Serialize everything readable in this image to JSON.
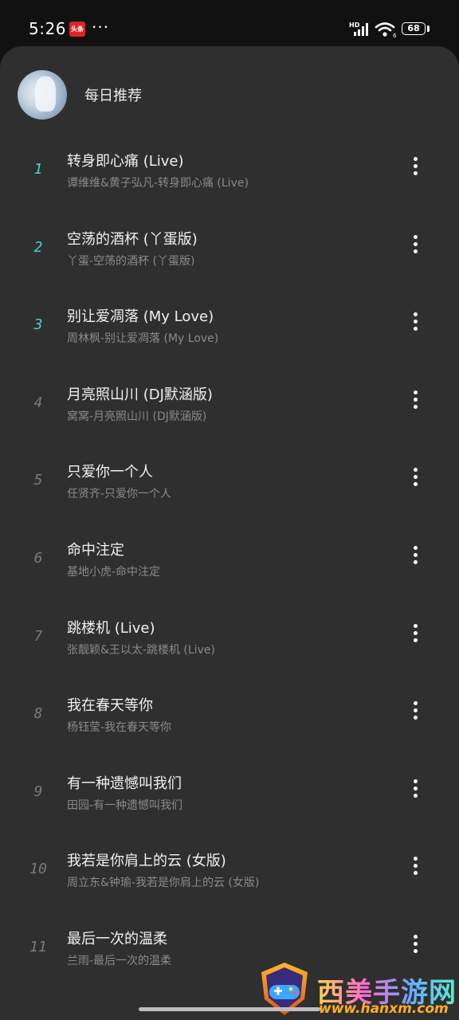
{
  "status_bar": {
    "time": "5:26",
    "news_icon_text": "头条",
    "more": "···",
    "hd_label": "HD",
    "wifi_sub": "6",
    "battery": "68"
  },
  "header": {
    "title": "每日推荐",
    "avatar": "avatar-image"
  },
  "songs": [
    {
      "num": "1",
      "title": "转身即心痛 (Live)",
      "subtitle": "谭维维&黄子弘凡-转身即心痛 (Live)",
      "highlight": true
    },
    {
      "num": "2",
      "title": "空荡的酒杯 (丫蛋版)",
      "subtitle": "丫蛋-空荡的酒杯 (丫蛋版)",
      "highlight": true
    },
    {
      "num": "3",
      "title": "别让爱凋落 (My Love)",
      "subtitle": "周林枫-别让爱凋落 (My Love)",
      "highlight": true
    },
    {
      "num": "4",
      "title": "月亮照山川 (DJ默涵版)",
      "subtitle": "窝窝-月亮照山川 (DJ默涵版)",
      "highlight": false
    },
    {
      "num": "5",
      "title": "只爱你一个人",
      "subtitle": "任贤齐-只爱你一个人",
      "highlight": false
    },
    {
      "num": "6",
      "title": "命中注定",
      "subtitle": "基地小虎-命中注定",
      "highlight": false
    },
    {
      "num": "7",
      "title": "跳楼机 (Live)",
      "subtitle": "张靓颖&王以太-跳楼机 (Live)",
      "highlight": false
    },
    {
      "num": "8",
      "title": "我在春天等你",
      "subtitle": "杨钰莹-我在春天等你",
      "highlight": false
    },
    {
      "num": "9",
      "title": "有一种遗憾叫我们",
      "subtitle": "田园-有一种遗憾叫我们",
      "highlight": false
    },
    {
      "num": "10",
      "title": "我若是你肩上的云 (女版)",
      "subtitle": "周立东&钟瑜-我若是你肩上的云 (女版)",
      "highlight": false
    },
    {
      "num": "11",
      "title": "最后一次的温柔",
      "subtitle": "兰雨-最后一次的温柔",
      "highlight": false
    }
  ],
  "watermark": {
    "name": "西美手游网",
    "url": "www.hanxm.com"
  },
  "colors": {
    "panel_bg": "#2f2f2f",
    "top_bg": "#111111",
    "highlight_num": "#3dd6d0",
    "muted_num": "#7a7a7a",
    "title_text": "#f0f0f0",
    "subtitle_text": "#8a8a8a"
  }
}
